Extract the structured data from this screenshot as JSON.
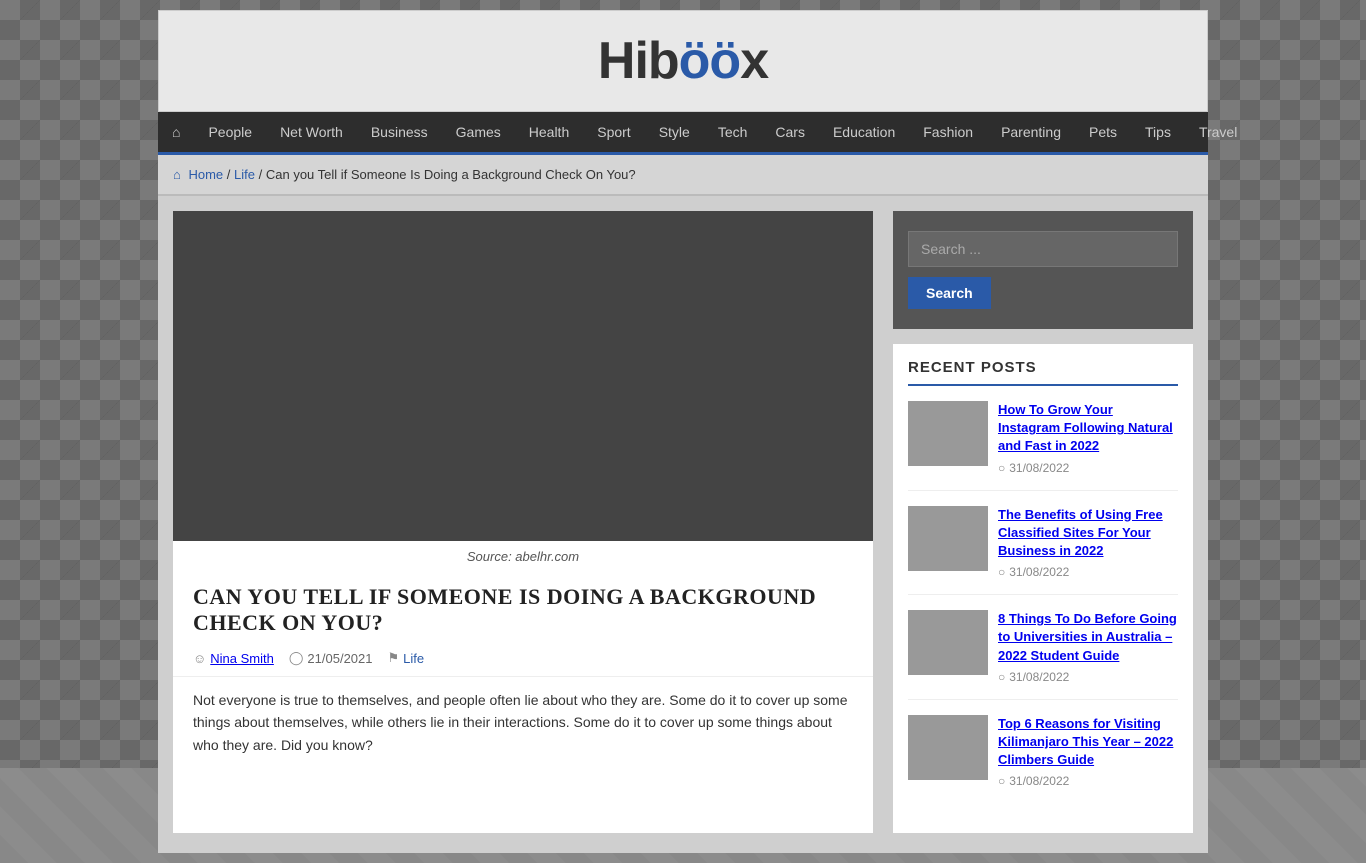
{
  "site": {
    "logo_text_1": "Hib",
    "logo_text_2": "x",
    "logo_eyes": "öö"
  },
  "nav": {
    "home_label": "Home",
    "items": [
      {
        "label": "People",
        "href": "#"
      },
      {
        "label": "Net Worth",
        "href": "#"
      },
      {
        "label": "Business",
        "href": "#"
      },
      {
        "label": "Games",
        "href": "#"
      },
      {
        "label": "Health",
        "href": "#"
      },
      {
        "label": "Sport",
        "href": "#"
      },
      {
        "label": "Style",
        "href": "#"
      },
      {
        "label": "Tech",
        "href": "#"
      },
      {
        "label": "Cars",
        "href": "#"
      },
      {
        "label": "Education",
        "href": "#"
      },
      {
        "label": "Fashion",
        "href": "#"
      },
      {
        "label": "Parenting",
        "href": "#"
      },
      {
        "label": "Pets",
        "href": "#"
      },
      {
        "label": "Tips",
        "href": "#"
      },
      {
        "label": "Travel",
        "href": "#"
      }
    ]
  },
  "breadcrumb": {
    "home": "Home",
    "section": "Life",
    "current": "Can you Tell if Someone Is Doing a Background Check On You?"
  },
  "article": {
    "title": "Can You Tell if Someone Is Doing a Background Check On You?",
    "image_caption": "Source: abelhr.com",
    "author": "Nina Smith",
    "date": "21/05/2021",
    "category": "Life",
    "body_text": "Not everyone is true to themselves, and people often lie about who they are. Some do it to cover up some things about themselves, while others lie in their interactions. Some do it to cover up some things about who they are. Did you know?"
  },
  "sidebar": {
    "search_placeholder": "Search ...",
    "search_button": "Search",
    "recent_posts_title": "Recent Posts",
    "recent_posts": [
      {
        "title": "How To Grow Your Instagram Following Natural and Fast in 2022",
        "date": "31/08/2022"
      },
      {
        "title": "The Benefits of Using Free Classified Sites For Your Business in 2022",
        "date": "31/08/2022"
      },
      {
        "title": "8 Things To Do Before Going to Universities in Australia – 2022 Student Guide",
        "date": "31/08/2022"
      },
      {
        "title": "Top 6 Reasons for Visiting Kilimanjaro This Year – 2022 Climbers Guide",
        "date": "31/08/2022"
      }
    ]
  }
}
